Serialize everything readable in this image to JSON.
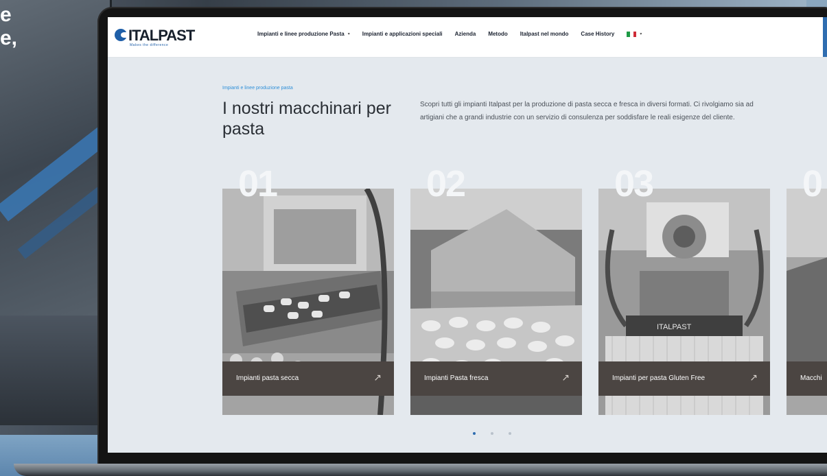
{
  "backdrop": {
    "text_lines": [
      "e",
      "e,"
    ]
  },
  "header": {
    "logo_text": "ITALPAST",
    "logo_tagline": "Makes the difference",
    "nav": [
      {
        "label": "Impianti e linee produzione Pasta",
        "has_dropdown": true
      },
      {
        "label": "Impianti e applicazioni speciali",
        "has_dropdown": false
      },
      {
        "label": "Azienda",
        "has_dropdown": false
      },
      {
        "label": "Metodo",
        "has_dropdown": false
      },
      {
        "label": "Italpast nel mondo",
        "has_dropdown": false
      },
      {
        "label": "Case History",
        "has_dropdown": false
      }
    ],
    "language_flag": "italy-flag-icon",
    "flag_colors": [
      "#1e9a46",
      "#ffffff",
      "#ce2b37"
    ]
  },
  "intro": {
    "eyebrow": "Impianti e linee produzione pasta",
    "title": "I nostri macchinari per pasta",
    "description": "Scopri tutti gli impianti Italpast per la produzione di pasta secca e fresca in diversi formati. Ci rivolgiamo sia ad artigiani che a grandi industrie con un servizio di consulenza per soddisfare le reali esigenze del cliente."
  },
  "cards": [
    {
      "number": "01",
      "label": "Impianti pasta secca",
      "icon": "arrow-up-right-icon"
    },
    {
      "number": "02",
      "label": "Impianti Pasta fresca",
      "icon": "arrow-up-right-icon"
    },
    {
      "number": "03",
      "label": "Impianti per pasta Gluten Free",
      "icon": "arrow-up-right-icon"
    },
    {
      "number": "0",
      "label": "Macchi",
      "icon": "arrow-up-right-icon"
    }
  ],
  "machine_badge": "ITALPAST",
  "pagination": {
    "active_index": 0,
    "count": 3
  },
  "colors": {
    "accent": "#2f6db0",
    "eyebrow": "#2e8fd8",
    "card_footer": "#4b4542",
    "screen_bg": "#e4e9ee"
  }
}
